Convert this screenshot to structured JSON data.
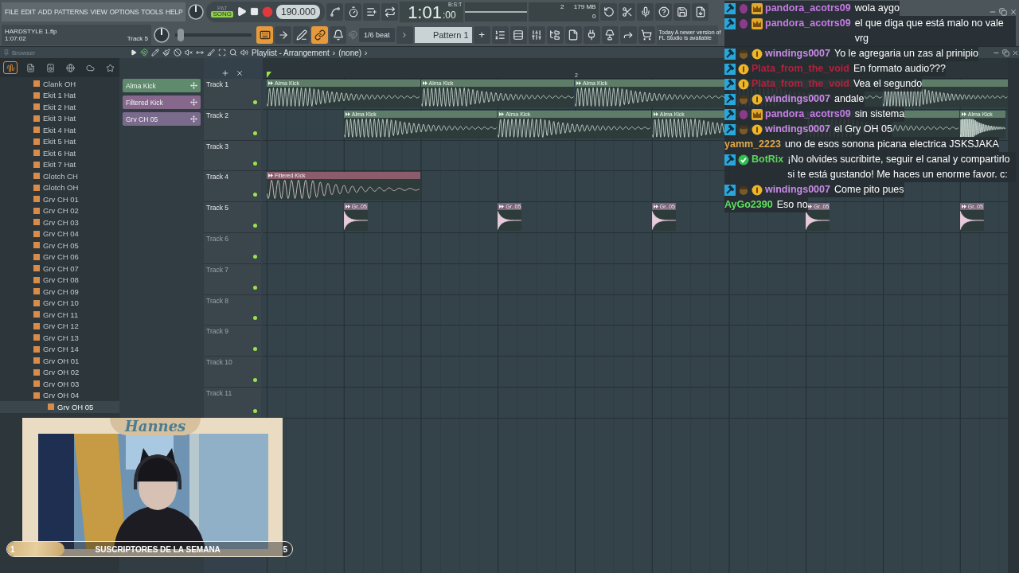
{
  "menu": [
    "FILE",
    "EDIT",
    "ADD",
    "PATTERNS",
    "VIEW",
    "OPTIONS",
    "TOOLS",
    "HELP"
  ],
  "transport": {
    "modes": [
      {
        "label": "PAT",
        "selected": false
      },
      {
        "label": "SONG",
        "selected": true
      }
    ],
    "tempo": "190.000"
  },
  "time": {
    "main": "1:01",
    "ticks": ":00",
    "unit": "B:S:T"
  },
  "monitor": {
    "cpu": "2",
    "memory": "179 MB",
    "polyphony": "0"
  },
  "project": {
    "file": "HARDSTYLE 1.flp",
    "length": "1:07:02",
    "hint": "Track 5"
  },
  "master_pitch": {
    "level": 0.03
  },
  "record_toggles": [
    {
      "on": true
    },
    {
      "on": false
    },
    {
      "on": false
    },
    {
      "on": true
    },
    {
      "on": false
    }
  ],
  "snap": "1/6 beat",
  "pattern": {
    "label": "Pattern 1",
    "add": "+"
  },
  "news": {
    "day": "Today",
    "lines": [
      "A newer version of",
      "FL Studio is available"
    ]
  },
  "browser": {
    "title": "Browser",
    "tabs": [
      {
        "selected": true
      },
      {
        "selected": false
      },
      {
        "selected": false
      },
      {
        "selected": false
      },
      {
        "selected": false
      },
      {
        "selected": false
      }
    ],
    "items": [
      {
        "label": "Clank OH",
        "selected": false
      },
      {
        "label": "Ekit 1 Hat",
        "selected": false
      },
      {
        "label": "Ekit 2 Hat",
        "selected": false
      },
      {
        "label": "Ekit 3 Hat",
        "selected": false
      },
      {
        "label": "Ekit 4 Hat",
        "selected": false
      },
      {
        "label": "Ekit 5 Hat",
        "selected": false
      },
      {
        "label": "Ekit 6 Hat",
        "selected": false
      },
      {
        "label": "Ekit 7 Hat",
        "selected": false
      },
      {
        "label": "Glotch CH",
        "selected": false
      },
      {
        "label": "Glotch OH",
        "selected": false
      },
      {
        "label": "Grv CH 01",
        "selected": false
      },
      {
        "label": "Grv CH 02",
        "selected": false
      },
      {
        "label": "Grv CH 03",
        "selected": false
      },
      {
        "label": "Grv CH 04",
        "selected": false
      },
      {
        "label": "Grv CH 05",
        "selected": false
      },
      {
        "label": "Grv CH 06",
        "selected": false
      },
      {
        "label": "Grv CH 07",
        "selected": false
      },
      {
        "label": "Grv CH 08",
        "selected": false
      },
      {
        "label": "Grv CH 09",
        "selected": false
      },
      {
        "label": "Grv CH 10",
        "selected": false
      },
      {
        "label": "Grv CH 11",
        "selected": false
      },
      {
        "label": "Grv CH 12",
        "selected": false
      },
      {
        "label": "Grv CH 13",
        "selected": false
      },
      {
        "label": "Grv CH 14",
        "selected": false
      },
      {
        "label": "Grv OH 01",
        "selected": false
      },
      {
        "label": "Grv OH 02",
        "selected": false
      },
      {
        "label": "Grv OH 03",
        "selected": false
      },
      {
        "label": "Grv OH 04",
        "selected": false
      },
      {
        "label": "Grv OH 05",
        "selected": true
      }
    ]
  },
  "playlist": {
    "breadcrumb": [
      {
        "label": "Playlist - Arrangement",
        "arrow": "›"
      },
      {
        "label": "(none)",
        "arrow": "›"
      }
    ],
    "channels": [
      {
        "label": "Alma Kick",
        "color": "#5f8a6c"
      },
      {
        "label": "Filtered Kick",
        "color": "#86688c"
      },
      {
        "label": "Grv CH 05",
        "color": "#7a6a8c"
      }
    ],
    "ruler": [
      "2"
    ],
    "tracks": [
      {
        "name": "Track 1",
        "active": true,
        "enabled": true,
        "clips": [
          {
            "label": "Alma Kick",
            "kind": "kick"
          },
          {
            "label": "Alma Kick",
            "kind": "kick"
          },
          {
            "label": "Alma Kick",
            "kind": "kick"
          },
          {
            "kind": "kick"
          },
          {
            "kind": "kick"
          }
        ]
      },
      {
        "name": "Track 2",
        "active": true,
        "enabled": true,
        "clips": [
          {
            "label": "Alma Kick",
            "kind": "kick"
          },
          {
            "label": "Alma Kick",
            "kind": "kick"
          },
          {
            "label": "Alma Kick",
            "kind": "kick"
          },
          {
            "kind": "kick"
          },
          {
            "label": "Alma Kick",
            "kind": "kick"
          }
        ]
      },
      {
        "name": "Track 3",
        "active": true,
        "enabled": true
      },
      {
        "name": "Track 4",
        "active": true,
        "enabled": true,
        "clips": [
          {
            "label": "Filtered Kick",
            "kind": "filtered"
          }
        ]
      },
      {
        "name": "Track 5",
        "active": true,
        "enabled": true,
        "clips": [
          {
            "label": "Gr..05",
            "kind": "hat"
          },
          {
            "label": "Gr..05",
            "kind": "hat"
          },
          {
            "label": "Gr..05",
            "kind": "hat"
          },
          {
            "label": "Gr..05",
            "kind": "hat"
          },
          {
            "label": "Gr..05",
            "kind": "hat"
          }
        ]
      },
      {
        "name": "Track 6",
        "active": false,
        "enabled": true
      },
      {
        "name": "Track 7",
        "active": false,
        "enabled": true
      },
      {
        "name": "Track 8",
        "active": false,
        "enabled": true
      },
      {
        "name": "Track 9",
        "active": false,
        "enabled": true
      },
      {
        "name": "Track 10",
        "active": false,
        "enabled": true
      },
      {
        "name": "Track 11",
        "active": false,
        "enabled": true
      }
    ]
  },
  "chat": [
    {
      "user": "pandora_acotrs09",
      "color": "#c77be6",
      "badges": [
        {
          "kind": "mod"
        },
        {
          "kind": "gem"
        },
        {
          "kind": "crown"
        }
      ],
      "text": "wola aygo"
    },
    {
      "user": "pandora_acotrs09",
      "color": "#c77be6",
      "badges": [
        {
          "kind": "mod"
        },
        {
          "kind": "gem"
        },
        {
          "kind": "crown"
        }
      ],
      "text": "el que diga que está malo no vale vrg"
    },
    {
      "user": "windings0007",
      "color": "#c98ae6",
      "badges": [
        {
          "kind": "mod"
        },
        {
          "kind": "acorn"
        },
        {
          "kind": "coin"
        }
      ],
      "text": "Yo le agregaria un zas al prinipio"
    },
    {
      "user": "Plata_from_the_void",
      "color": "#b3203c",
      "badges": [
        {
          "kind": "mod"
        },
        {
          "kind": "coin"
        }
      ],
      "text": "En formato audio???"
    },
    {
      "user": "Plata_from_the_void",
      "color": "#b3203c",
      "badges": [
        {
          "kind": "mod"
        },
        {
          "kind": "coin"
        }
      ],
      "text": "Vea el segundo"
    },
    {
      "user": "windings0007",
      "color": "#c98ae6",
      "badges": [
        {
          "kind": "mod"
        },
        {
          "kind": "acorn"
        },
        {
          "kind": "coin"
        }
      ],
      "text": "andale"
    },
    {
      "user": "pandora_acotrs09",
      "color": "#c77be6",
      "badges": [
        {
          "kind": "mod"
        },
        {
          "kind": "gem"
        },
        {
          "kind": "crown"
        }
      ],
      "text": "sin sistema"
    },
    {
      "user": "windings0007",
      "color": "#c98ae6",
      "badges": [
        {
          "kind": "mod"
        },
        {
          "kind": "acorn"
        },
        {
          "kind": "coin"
        }
      ],
      "text": "el Gry OH 05"
    },
    {
      "user": "yamm_2223",
      "color": "#e0a94c",
      "text": "uno de esos sonona picana electrica JSKSJAKA"
    },
    {
      "user": "BotRix",
      "color": "#5cd65c",
      "badges": [
        {
          "kind": "mod"
        },
        {
          "kind": "verified"
        }
      ],
      "text": "¡No olvides sucribirte, seguir el canal y compartirlo si te está gustando! Me haces un enorme favor. c:"
    },
    {
      "user": "windings0007",
      "color": "#c98ae6",
      "badges": [
        {
          "kind": "mod"
        },
        {
          "kind": "acorn"
        },
        {
          "kind": "coin"
        }
      ],
      "text": "Come pito pues"
    },
    {
      "user": "AyGo2390",
      "color": "#5ee05e",
      "text": "Eso no"
    }
  ],
  "webcam": {
    "name": "Hannes",
    "banner": "SUSCRIPTORES DE LA SEMANA",
    "left_count": "1",
    "right_count": "5"
  }
}
